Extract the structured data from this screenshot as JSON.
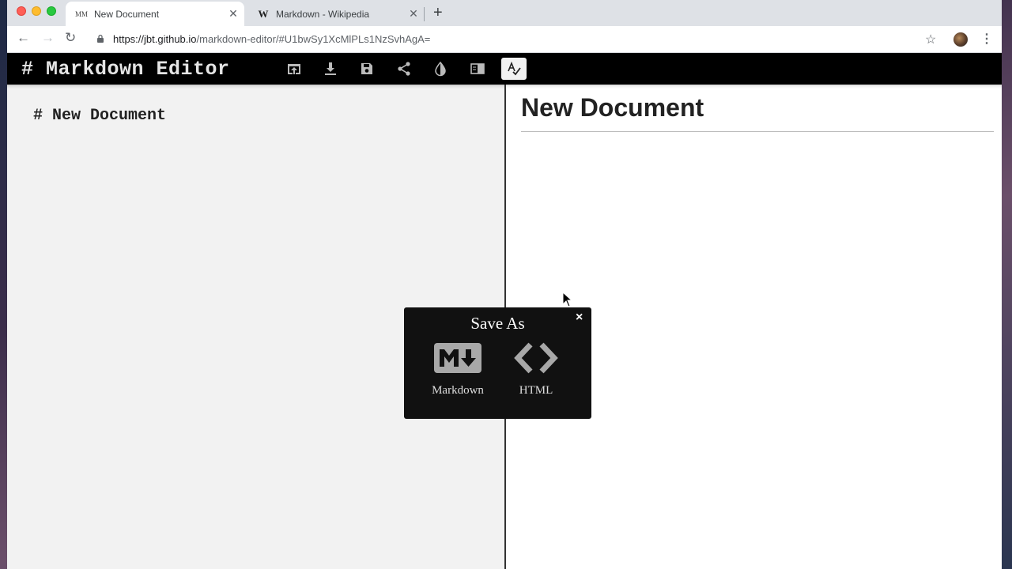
{
  "browser": {
    "tabs": [
      {
        "title": "New Document",
        "favicon": "MM",
        "active": true
      },
      {
        "title": "Markdown - Wikipedia",
        "favicon": "W",
        "active": false
      }
    ],
    "close_glyph": "✕",
    "new_tab_glyph": "+",
    "url_host": "https://jbt.github.io",
    "url_path": "/markdown-editor/#U1bwSy1XcMlPLs1NzSvhAgA="
  },
  "app": {
    "title": "# Markdown Editor",
    "toolbar_icons": [
      "open-file-icon",
      "download-icon",
      "save-icon",
      "share-icon",
      "contrast-icon",
      "split-view-icon",
      "spellcheck-icon"
    ]
  },
  "editor": {
    "content": "# New Document"
  },
  "preview": {
    "heading": "New Document"
  },
  "modal": {
    "title": "Save As",
    "close": "×",
    "options": [
      {
        "label": "Markdown",
        "icon": "markdown-icon"
      },
      {
        "label": "HTML",
        "icon": "code-brackets-icon"
      }
    ]
  },
  "colors": {
    "header_bg": "#000000",
    "editor_bg": "#f2f2f2",
    "modal_bg": "#111111"
  }
}
